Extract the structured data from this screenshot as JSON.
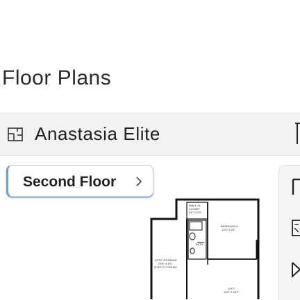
{
  "page": {
    "title": "Floor Plans"
  },
  "model": {
    "name": "Anastasia Elite",
    "icon": "floorplan-icon"
  },
  "floor_select": {
    "label": "Second Floor",
    "chevron_icon": "chevron-right-icon"
  },
  "side_panel": {
    "buttons": [
      "toggle-icon",
      "save-icon",
      "send-icon"
    ]
  },
  "plan": {
    "rooms": {
      "walkin": {
        "name": "WALK-IN",
        "name2": "CLOSET",
        "dims": "5'5\" X 5'3\""
      },
      "bedroom4": {
        "name": "BEDROOM 4",
        "dims": "13'9\" X 13'"
      },
      "bath": {
        "name": "BATH"
      },
      "attic": {
        "name": "ATTIC STORAGE",
        "dims": "23'6\" X 9'1\"",
        "note": "SLOPE TO 3' CEILING"
      },
      "loft": {
        "name": "LOFT",
        "dims": "18'5\" X 16'7\""
      }
    }
  },
  "colors": {
    "accent": "#4f8fd6",
    "bar_bg": "#f2f2f2",
    "text": "#1e1e1e"
  }
}
